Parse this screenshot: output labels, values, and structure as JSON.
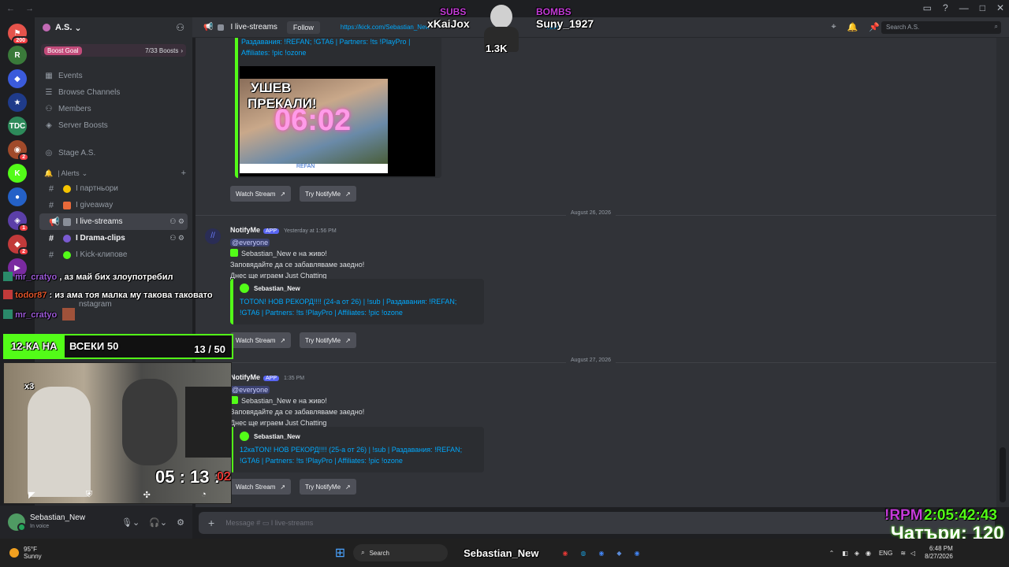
{
  "window": {
    "nav": [
      "←",
      "→"
    ],
    "controls": [
      "▭",
      "?",
      "—",
      "□",
      "✕"
    ]
  },
  "servers": [
    {
      "label": "⚑",
      "badge": "200",
      "color": "#e5534b"
    },
    {
      "label": "R",
      "badge": "",
      "color": "#3a7a3a"
    },
    {
      "label": "◆",
      "badge": "",
      "color": "#3b5bdb"
    },
    {
      "label": "★",
      "badge": "",
      "color": "#1f3b8a"
    },
    {
      "label": "TDC",
      "badge": "",
      "color": "#2d8a5a"
    },
    {
      "label": "◉",
      "badge": "2",
      "color": "#a04a2a"
    },
    {
      "label": "K",
      "badge": "",
      "color": "#53fc18"
    },
    {
      "label": "●",
      "badge": "",
      "color": "#2461c7"
    },
    {
      "label": "◈",
      "badge": "1",
      "color": "#5b3fa8"
    },
    {
      "label": "◆",
      "badge": "2",
      "color": "#c23a3a"
    },
    {
      "label": "▶",
      "badge": "",
      "color": "#7a2aa0"
    }
  ],
  "guild": {
    "name": "A.S.",
    "boost_label": "Boost Goal",
    "boost_count": "7/33 Boosts"
  },
  "menu": [
    "Events",
    "Browse Channels",
    "Members",
    "Server Boosts",
    "Stage A.S."
  ],
  "alerts_category": "| Alerts",
  "channels": [
    {
      "name": "I партньори",
      "emoji_color": "#f5c400"
    },
    {
      "name": "I giveaway",
      "emoji_color": "#e86a3a"
    },
    {
      "name": "I live-streams",
      "emoji_color": "#8a8f99"
    },
    {
      "name": "I Drama-clips",
      "emoji_color": "#7a5ad1"
    },
    {
      "name": "I Kick-клипове",
      "emoji_color": "#53fc18"
    },
    {
      "name": "nstagram",
      "emoji_color": "#c23a3a"
    }
  ],
  "user": {
    "name": "Sebastian_New",
    "status": "In voice"
  },
  "header": {
    "channel": "I live-streams",
    "follow": "Follow",
    "url": "https://kick.com/Sebastian_New",
    "url_tail": "new",
    "search_placeholder": "Search A.S."
  },
  "stream_overlay": {
    "subs_label": "SUBS",
    "subs_name": "xKaiJox",
    "bombs_label": "BOMBS",
    "bombs_name": "Suny_1927",
    "counter": "1.3K"
  },
  "top_embed": {
    "line1": "Раздавания: !REFAN; !GTA6 | Partners: !ts !PlayPro |",
    "line2": "Affiliates: !pic !ozone",
    "thumb_text1": "УШЕВ",
    "thumb_text2": "ПРЕКАЛИ!",
    "thumb_timer": "06:02",
    "thumb_footer": "REFAN"
  },
  "buttons": {
    "watch": "Watch Stream",
    "try": "Try NotifyMe"
  },
  "dates": [
    "August 26, 2026",
    "August 27, 2026"
  ],
  "messages": [
    {
      "author": "NotifyMe",
      "app": "APP",
      "time": "Yesterday at 1:56 PM",
      "mention": "@everyone",
      "line1": "Sebastian_New е на живо!",
      "line2": "Заповядайте да се забавляваме заедно!",
      "line3": "Днес ще играем Just Chatting",
      "embed_author": "Sebastian_New",
      "embed_line1": "TOTON! НОВ РЕКОРД!!!! (24-а от 26) | !sub | Раздавания: !REFAN;",
      "embed_line2": "!GTA6 | Partners: !ts !PlayPro | Affiliates: !pic !ozone"
    },
    {
      "author": "NotifyMe",
      "app": "APP",
      "time": "1:35 PM",
      "mention": "@everyone",
      "line1": "Sebastian_New е на живо!",
      "line2": "Заповядайте да се забавляваме заедно!",
      "line3": "Днес ще играем Just Chatting",
      "embed_author": "Sebastian_New",
      "embed_line1": "12каTON! НОВ РЕКОРД!!!! (25-а от 26) | !sub | Раздавания: !REFAN;",
      "embed_line2": "!GTA6 | Partners: !ts !PlayPro | Affiliates: !pic !ozone"
    }
  ],
  "composer": {
    "placeholder": "Message # ▭ I live-streams"
  },
  "chat_overlay": [
    {
      "user": "mr_cratyo",
      "text": ", аз май бих злоупотребил",
      "color": "#9b59d6"
    },
    {
      "user": "todor87",
      "text": ": из ама тоя малка му такова таковато",
      "color": "#e0542a"
    },
    {
      "user": "mr_cratyo",
      "text": "",
      "color": "#9b59d6"
    }
  ],
  "goal": {
    "label": "12-КА НА",
    "label2": "ВСЕКИ 50",
    "progress": "13 / 50"
  },
  "cam": {
    "timer_main": "05 : 13 :",
    "timer_ms": "02",
    "multiplier": "x3"
  },
  "cam_icons": [
    "◤",
    "⛨",
    "✣",
    "◔"
  ],
  "rpm": {
    "label": "!RPM",
    "time": "2:05:42:43",
    "bottom": "Чатъри: 120"
  },
  "taskbar": {
    "weather_temp": "95°F",
    "weather_desc": "Sunny",
    "search": "Search",
    "streamer": "Sebastian_New",
    "lang": "ENG",
    "time": "6:48 PM",
    "date": "8/27/2026"
  }
}
